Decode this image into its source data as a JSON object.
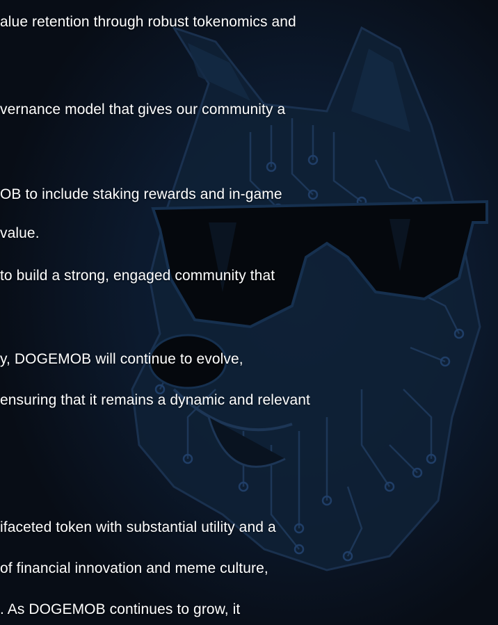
{
  "background": {
    "illustration": "cyber-doge-mascot-with-sunglasses",
    "colors": {
      "base": "#080d16",
      "glow": "#10223a",
      "circuit": "#1f3a5c",
      "lens": "#05080d"
    }
  },
  "paragraph_lines": [
    "alue retention through robust tokenomics and",
    "vernance model that gives our community a",
    "OB to include staking rewards and in-game",
    "value.",
    "to build a strong, engaged community that",
    "y, DOGEMOB will continue to evolve,",
    "ensuring that it remains a dynamic and relevant",
    "ifaceted token with substantial utility and a",
    "of financial innovation and meme culture,",
    ". As DOGEMOB continues to grow, it"
  ]
}
